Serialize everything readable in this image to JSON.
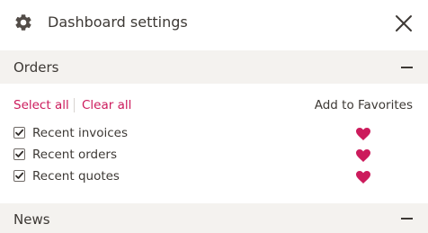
{
  "header": {
    "title": "Dashboard settings",
    "icon": "gear-icon",
    "close_icon": "close-icon"
  },
  "sections": [
    {
      "title": "Orders",
      "collapse_icon": "minus-icon",
      "select_all_label": "Select all",
      "clear_all_label": "Clear all",
      "favorites_header": "Add to Favorites",
      "items": [
        {
          "label": "Recent invoices",
          "checked": true,
          "favorite": true
        },
        {
          "label": "Recent orders",
          "checked": true,
          "favorite": true
        },
        {
          "label": "Recent quotes",
          "checked": true,
          "favorite": true
        }
      ]
    },
    {
      "title": "News",
      "collapse_icon": "minus-icon"
    }
  ],
  "colors": {
    "accent": "#cc1b5c",
    "text": "#3d3935",
    "section_bg": "#f4f2ef",
    "background": "#ffffff"
  }
}
